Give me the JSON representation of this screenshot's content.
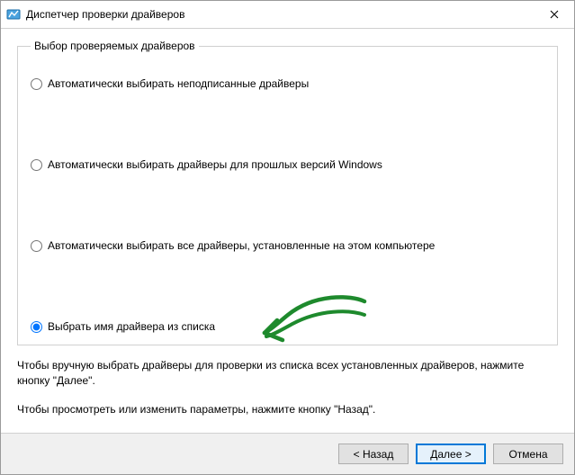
{
  "window": {
    "title": "Диспетчер проверки драйверов"
  },
  "group": {
    "legend": "Выбор проверяемых драйверов",
    "options": {
      "unsigned": "Автоматически выбирать неподписанные драйверы",
      "oldwin": "Автоматически выбирать драйверы для прошлых версий Windows",
      "alldrivers": "Автоматически выбирать все драйверы, установленные на этом компьютере",
      "fromlist": "Выбрать имя драйвера из списка"
    },
    "selected": "fromlist"
  },
  "help": {
    "p1": "Чтобы вручную выбрать драйверы для проверки из списка всех установленных драйверов, нажмите кнопку \"Далее\".",
    "p2": "Чтобы просмотреть или изменить параметры, нажмите кнопку \"Назад\"."
  },
  "footer": {
    "back": "< Назад",
    "next": "Далее >",
    "cancel": "Отмена"
  }
}
